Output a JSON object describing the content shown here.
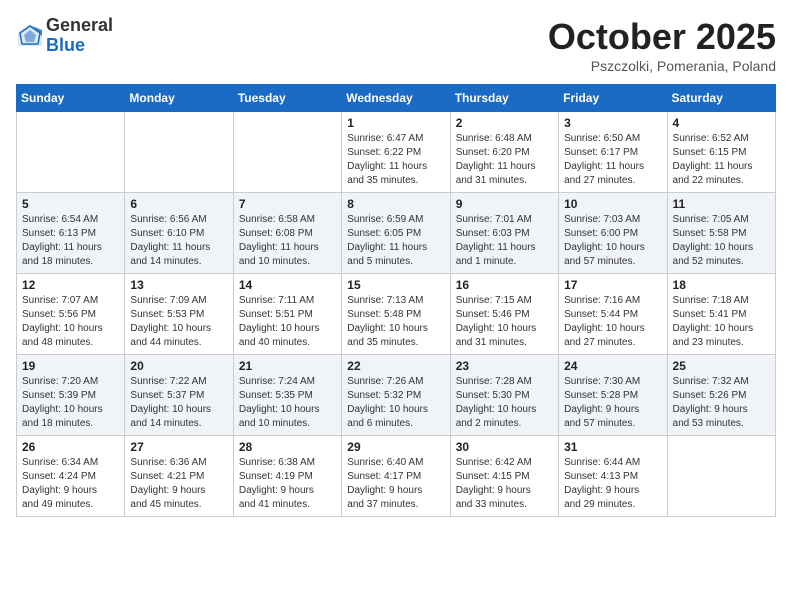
{
  "logo": {
    "general": "General",
    "blue": "Blue"
  },
  "title": "October 2025",
  "location": "Pszczolki, Pomerania, Poland",
  "headers": [
    "Sunday",
    "Monday",
    "Tuesday",
    "Wednesday",
    "Thursday",
    "Friday",
    "Saturday"
  ],
  "weeks": [
    [
      {
        "day": "",
        "info": ""
      },
      {
        "day": "",
        "info": ""
      },
      {
        "day": "",
        "info": ""
      },
      {
        "day": "1",
        "info": "Sunrise: 6:47 AM\nSunset: 6:22 PM\nDaylight: 11 hours\nand 35 minutes."
      },
      {
        "day": "2",
        "info": "Sunrise: 6:48 AM\nSunset: 6:20 PM\nDaylight: 11 hours\nand 31 minutes."
      },
      {
        "day": "3",
        "info": "Sunrise: 6:50 AM\nSunset: 6:17 PM\nDaylight: 11 hours\nand 27 minutes."
      },
      {
        "day": "4",
        "info": "Sunrise: 6:52 AM\nSunset: 6:15 PM\nDaylight: 11 hours\nand 22 minutes."
      }
    ],
    [
      {
        "day": "5",
        "info": "Sunrise: 6:54 AM\nSunset: 6:13 PM\nDaylight: 11 hours\nand 18 minutes."
      },
      {
        "day": "6",
        "info": "Sunrise: 6:56 AM\nSunset: 6:10 PM\nDaylight: 11 hours\nand 14 minutes."
      },
      {
        "day": "7",
        "info": "Sunrise: 6:58 AM\nSunset: 6:08 PM\nDaylight: 11 hours\nand 10 minutes."
      },
      {
        "day": "8",
        "info": "Sunrise: 6:59 AM\nSunset: 6:05 PM\nDaylight: 11 hours\nand 5 minutes."
      },
      {
        "day": "9",
        "info": "Sunrise: 7:01 AM\nSunset: 6:03 PM\nDaylight: 11 hours\nand 1 minute."
      },
      {
        "day": "10",
        "info": "Sunrise: 7:03 AM\nSunset: 6:00 PM\nDaylight: 10 hours\nand 57 minutes."
      },
      {
        "day": "11",
        "info": "Sunrise: 7:05 AM\nSunset: 5:58 PM\nDaylight: 10 hours\nand 52 minutes."
      }
    ],
    [
      {
        "day": "12",
        "info": "Sunrise: 7:07 AM\nSunset: 5:56 PM\nDaylight: 10 hours\nand 48 minutes."
      },
      {
        "day": "13",
        "info": "Sunrise: 7:09 AM\nSunset: 5:53 PM\nDaylight: 10 hours\nand 44 minutes."
      },
      {
        "day": "14",
        "info": "Sunrise: 7:11 AM\nSunset: 5:51 PM\nDaylight: 10 hours\nand 40 minutes."
      },
      {
        "day": "15",
        "info": "Sunrise: 7:13 AM\nSunset: 5:48 PM\nDaylight: 10 hours\nand 35 minutes."
      },
      {
        "day": "16",
        "info": "Sunrise: 7:15 AM\nSunset: 5:46 PM\nDaylight: 10 hours\nand 31 minutes."
      },
      {
        "day": "17",
        "info": "Sunrise: 7:16 AM\nSunset: 5:44 PM\nDaylight: 10 hours\nand 27 minutes."
      },
      {
        "day": "18",
        "info": "Sunrise: 7:18 AM\nSunset: 5:41 PM\nDaylight: 10 hours\nand 23 minutes."
      }
    ],
    [
      {
        "day": "19",
        "info": "Sunrise: 7:20 AM\nSunset: 5:39 PM\nDaylight: 10 hours\nand 18 minutes."
      },
      {
        "day": "20",
        "info": "Sunrise: 7:22 AM\nSunset: 5:37 PM\nDaylight: 10 hours\nand 14 minutes."
      },
      {
        "day": "21",
        "info": "Sunrise: 7:24 AM\nSunset: 5:35 PM\nDaylight: 10 hours\nand 10 minutes."
      },
      {
        "day": "22",
        "info": "Sunrise: 7:26 AM\nSunset: 5:32 PM\nDaylight: 10 hours\nand 6 minutes."
      },
      {
        "day": "23",
        "info": "Sunrise: 7:28 AM\nSunset: 5:30 PM\nDaylight: 10 hours\nand 2 minutes."
      },
      {
        "day": "24",
        "info": "Sunrise: 7:30 AM\nSunset: 5:28 PM\nDaylight: 9 hours\nand 57 minutes."
      },
      {
        "day": "25",
        "info": "Sunrise: 7:32 AM\nSunset: 5:26 PM\nDaylight: 9 hours\nand 53 minutes."
      }
    ],
    [
      {
        "day": "26",
        "info": "Sunrise: 6:34 AM\nSunset: 4:24 PM\nDaylight: 9 hours\nand 49 minutes."
      },
      {
        "day": "27",
        "info": "Sunrise: 6:36 AM\nSunset: 4:21 PM\nDaylight: 9 hours\nand 45 minutes."
      },
      {
        "day": "28",
        "info": "Sunrise: 6:38 AM\nSunset: 4:19 PM\nDaylight: 9 hours\nand 41 minutes."
      },
      {
        "day": "29",
        "info": "Sunrise: 6:40 AM\nSunset: 4:17 PM\nDaylight: 9 hours\nand 37 minutes."
      },
      {
        "day": "30",
        "info": "Sunrise: 6:42 AM\nSunset: 4:15 PM\nDaylight: 9 hours\nand 33 minutes."
      },
      {
        "day": "31",
        "info": "Sunrise: 6:44 AM\nSunset: 4:13 PM\nDaylight: 9 hours\nand 29 minutes."
      },
      {
        "day": "",
        "info": ""
      }
    ]
  ]
}
